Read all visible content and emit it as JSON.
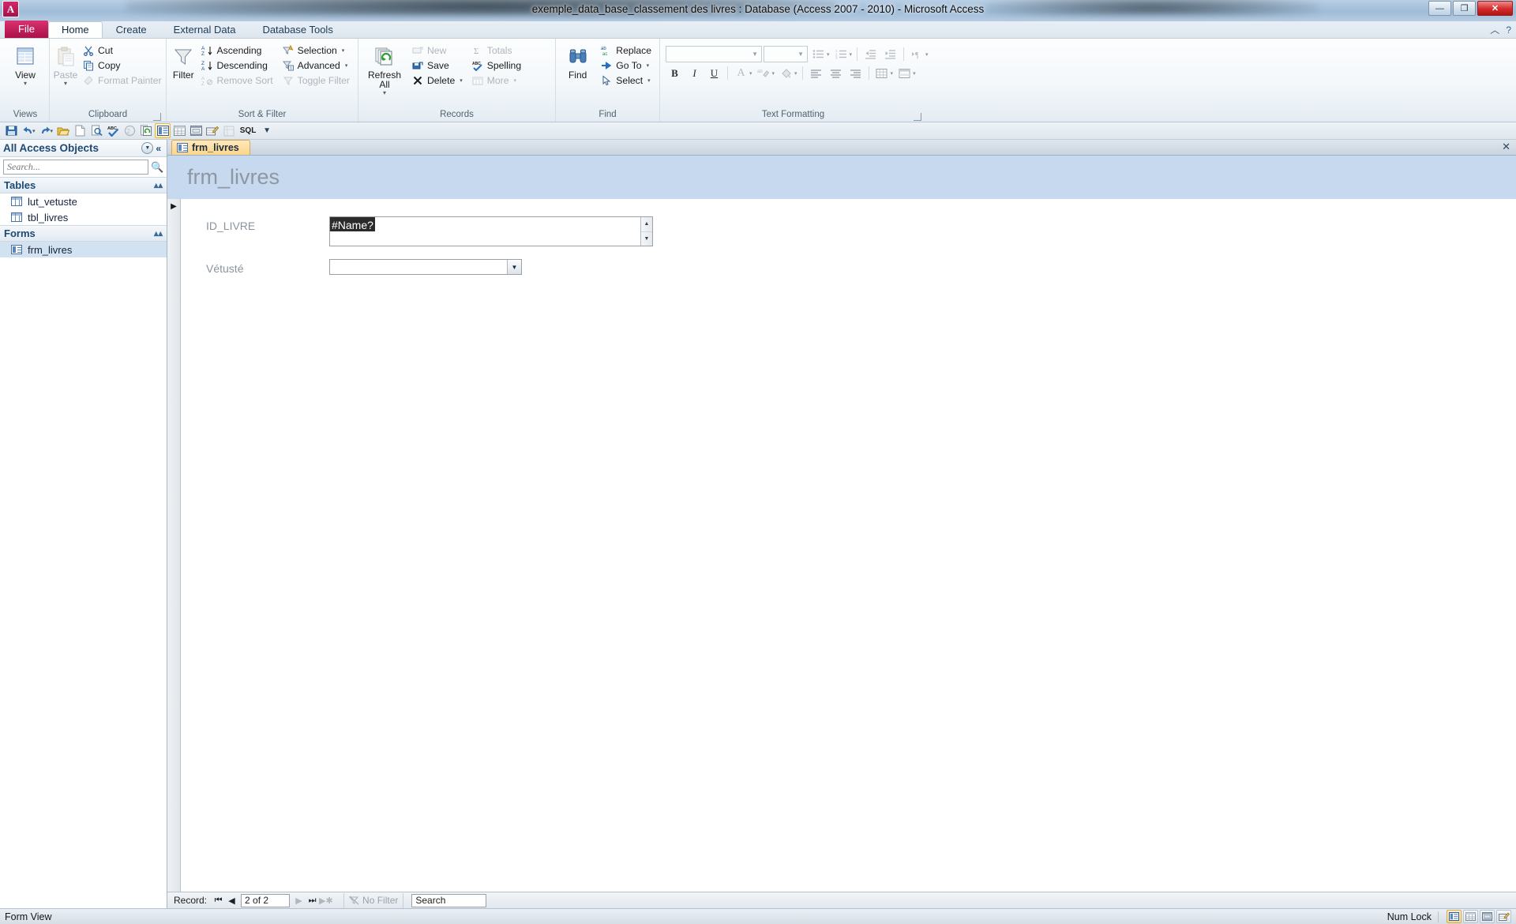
{
  "window": {
    "title": "exemple_data_base_classement des livres : Database (Access 2007 - 2010)  -  Microsoft Access",
    "app_logo_letter": "A",
    "minimize_label": "—",
    "restore_label": "❐",
    "close_label": "✕"
  },
  "ribbon_tabs": {
    "file": "File",
    "items": [
      {
        "label": "Home",
        "active": true
      },
      {
        "label": "Create",
        "active": false
      },
      {
        "label": "External Data",
        "active": false
      },
      {
        "label": "Database Tools",
        "active": false
      }
    ],
    "help_icon": "help-icon",
    "minimize_ribbon_icon": "chevron-up-icon"
  },
  "ribbon": {
    "groups": [
      {
        "name": "Views",
        "label": "Views",
        "big_buttons": [
          {
            "label": "View",
            "icon": "view-datasheet-icon",
            "has_dropdown": true,
            "disabled": false
          }
        ],
        "small_buttons": []
      },
      {
        "name": "Clipboard",
        "label": "Clipboard",
        "has_dialog_launcher": true,
        "big_buttons": [
          {
            "label": "Paste",
            "icon": "paste-icon",
            "has_dropdown": true,
            "disabled": true
          }
        ],
        "small_buttons": [
          {
            "label": "Cut",
            "icon": "scissors-icon",
            "disabled": false
          },
          {
            "label": "Copy",
            "icon": "copy-icon",
            "disabled": false
          },
          {
            "label": "Format Painter",
            "icon": "format-painter-icon",
            "disabled": true
          }
        ]
      },
      {
        "name": "Sort & Filter",
        "label": "Sort & Filter",
        "big_buttons": [
          {
            "label": "Filter",
            "icon": "funnel-icon",
            "has_dropdown": false,
            "disabled": false
          }
        ],
        "small_buttons": [
          {
            "label": "Ascending",
            "icon": "sort-ascending-icon",
            "disabled": false
          },
          {
            "label": "Descending",
            "icon": "sort-descending-icon",
            "disabled": false
          },
          {
            "label": "Remove Sort",
            "icon": "remove-sort-icon",
            "disabled": true
          },
          {
            "label": "Selection",
            "icon": "selection-icon",
            "disabled": false,
            "has_dropdown": true
          },
          {
            "label": "Advanced",
            "icon": "advanced-filter-icon",
            "disabled": false,
            "has_dropdown": true
          },
          {
            "label": "Toggle Filter",
            "icon": "toggle-filter-icon",
            "disabled": true
          }
        ]
      },
      {
        "name": "Records",
        "label": "Records",
        "big_buttons": [
          {
            "label": "Refresh All",
            "icon": "refresh-all-icon",
            "has_dropdown": true,
            "disabled": false
          }
        ],
        "small_buttons": [
          {
            "label": "New",
            "icon": "new-record-icon",
            "disabled": true
          },
          {
            "label": "Save",
            "icon": "save-record-icon",
            "disabled": false
          },
          {
            "label": "Delete",
            "icon": "delete-record-icon",
            "disabled": false,
            "has_dropdown": true
          },
          {
            "label": "Totals",
            "icon": "totals-sigma-icon",
            "disabled": true
          },
          {
            "label": "Spelling",
            "icon": "spelling-icon",
            "disabled": false
          },
          {
            "label": "More",
            "icon": "more-icon",
            "disabled": true,
            "has_dropdown": true
          }
        ]
      },
      {
        "name": "Find",
        "label": "Find",
        "big_buttons": [
          {
            "label": "Find",
            "icon": "binoculars-icon",
            "has_dropdown": false,
            "disabled": false
          }
        ],
        "small_buttons": [
          {
            "label": "Replace",
            "icon": "replace-icon",
            "disabled": false
          },
          {
            "label": "Go To",
            "icon": "goto-arrow-icon",
            "disabled": false,
            "has_dropdown": true
          },
          {
            "label": "Select",
            "icon": "select-pointer-icon",
            "disabled": false,
            "has_dropdown": true
          }
        ]
      }
    ],
    "text_formatting": {
      "label": "Text Formatting",
      "has_dialog_launcher": true,
      "font_name_value": "",
      "font_size_value": "",
      "buttons_row1": [
        {
          "icon": "bullets-icon",
          "label": "Bulleted List",
          "disabled": true,
          "has_dropdown": true
        },
        {
          "icon": "numbering-icon",
          "label": "Numbered List",
          "disabled": true,
          "has_dropdown": true
        },
        {
          "icon": "decrease-indent-icon",
          "label": "Decrease Indent",
          "disabled": true
        },
        {
          "icon": "increase-indent-icon",
          "label": "Increase Indent",
          "disabled": true
        },
        {
          "icon": "text-direction-icon",
          "label": "Text Direction",
          "disabled": true,
          "has_dropdown": true
        }
      ],
      "buttons_row2": [
        {
          "icon": "bold-icon",
          "label": "Bold",
          "glyph": "B",
          "disabled": false
        },
        {
          "icon": "italic-icon",
          "label": "Italic",
          "glyph": "I",
          "disabled": false
        },
        {
          "icon": "underline-icon",
          "label": "Underline",
          "glyph": "U",
          "disabled": false
        },
        {
          "icon": "font-color-icon",
          "label": "Font Color",
          "glyph": "A",
          "disabled": true,
          "has_dropdown": true
        },
        {
          "icon": "highlight-color-icon",
          "label": "Text Highlight Color",
          "glyph": "ab",
          "disabled": true,
          "has_dropdown": true
        },
        {
          "icon": "fill-color-icon",
          "label": "Background Color",
          "glyph": "◇",
          "disabled": true,
          "has_dropdown": true
        },
        {
          "icon": "align-left-icon",
          "label": "Align Left",
          "disabled": true
        },
        {
          "icon": "align-center-icon",
          "label": "Center",
          "disabled": true
        },
        {
          "icon": "align-right-icon",
          "label": "Align Right",
          "disabled": true
        },
        {
          "icon": "gridlines-icon",
          "label": "Gridlines",
          "disabled": true,
          "has_dropdown": true
        },
        {
          "icon": "alternate-row-color-icon",
          "label": "Alternate Row Color",
          "disabled": true,
          "has_dropdown": true
        }
      ]
    }
  },
  "quick_access": {
    "buttons": [
      {
        "icon": "save-icon",
        "label": "Save",
        "selected": false
      },
      {
        "icon": "undo-icon",
        "label": "Undo",
        "selected": false,
        "has_dropdown": true
      },
      {
        "icon": "redo-icon",
        "label": "Redo",
        "selected": false,
        "has_dropdown": true
      },
      {
        "icon": "open-folder-icon",
        "label": "Open",
        "selected": false
      },
      {
        "icon": "new-document-icon",
        "label": "New",
        "selected": false
      },
      {
        "icon": "print-preview-icon",
        "label": "Print Preview",
        "selected": false
      },
      {
        "icon": "spelling-check-icon",
        "label": "Spelling",
        "selected": false
      },
      {
        "icon": "undo-circle-icon",
        "label": "Undo History",
        "selected": false
      },
      {
        "icon": "refresh-all-small-icon",
        "label": "Refresh All",
        "selected": false
      },
      {
        "icon": "form-view-icon",
        "label": "Form View",
        "selected": true
      },
      {
        "icon": "datasheet-view-icon",
        "label": "Datasheet View",
        "selected": false
      },
      {
        "icon": "layout-view-icon",
        "label": "Layout View",
        "selected": false
      },
      {
        "icon": "design-view-icon",
        "label": "Design View",
        "selected": false
      },
      {
        "icon": "pivot-icon",
        "label": "PivotTable View",
        "selected": false
      },
      {
        "icon": "sql-view-icon",
        "label": "SQL",
        "selected": false,
        "text": "SQL"
      },
      {
        "icon": "customize-qat-icon",
        "label": "Customize Quick Access Toolbar",
        "selected": false
      }
    ]
  },
  "navigation_pane": {
    "header": "All Access Objects",
    "dropdown_icon": "chevron-down-circle-icon",
    "collapse_icon": "double-chevron-left-icon",
    "search_placeholder": "Search...",
    "search_value": "",
    "search_icon": "magnifier-icon",
    "groups": [
      {
        "label": "Tables",
        "collapse_icon": "chevron-up-icon",
        "items": [
          {
            "label": "lut_vetuste",
            "icon": "table-icon",
            "selected": false
          },
          {
            "label": "tbl_livres",
            "icon": "table-icon",
            "selected": false
          }
        ]
      },
      {
        "label": "Forms",
        "collapse_icon": "chevron-up-icon",
        "items": [
          {
            "label": "frm_livres",
            "icon": "form-icon",
            "selected": true
          }
        ]
      }
    ]
  },
  "document": {
    "tabs": [
      {
        "label": "frm_livres",
        "icon": "form-icon",
        "active": true
      }
    ],
    "close_label": "✕",
    "form_title": "frm_livres",
    "record_selector_icon": "right-triangle-icon",
    "fields": [
      {
        "label": "ID_LIVRE",
        "type": "textbox",
        "value": "#Name?",
        "selected": true,
        "has_scrollbar": true,
        "scroll_up_icon": "triangle-up-icon",
        "scroll_down_icon": "triangle-down-icon"
      },
      {
        "label": "Vétusté",
        "type": "combobox",
        "value": "",
        "selected": false,
        "dropdown_icon": "triangle-down-icon"
      }
    ]
  },
  "record_nav": {
    "label": "Record:",
    "first_icon": "first-record-icon",
    "prev_icon": "prev-record-icon",
    "position_text": "2 of 2",
    "next_icon": "next-record-icon",
    "last_icon": "last-record-icon",
    "new_icon": "new-record-icon",
    "filter_icon": "filter-off-icon",
    "filter_label": "No Filter",
    "search_value": "Search"
  },
  "status_bar": {
    "view_mode": "Form View",
    "num_lock": "Num Lock",
    "view_buttons": [
      {
        "icon": "form-view-icon",
        "label": "Form View",
        "active": true
      },
      {
        "icon": "datasheet-view-icon",
        "label": "Datasheet View",
        "active": false
      },
      {
        "icon": "layout-view-icon",
        "label": "Layout View",
        "active": false
      },
      {
        "icon": "design-view-icon",
        "label": "Design View",
        "active": false
      }
    ]
  },
  "colors": {
    "accent_file_tab": "#c2215b",
    "form_header_bg": "#c6d9ee",
    "doc_tab_bg": "#fbd58a",
    "nav_selected": "#d3e2f0",
    "selection_bg": "#2b2b2b"
  }
}
